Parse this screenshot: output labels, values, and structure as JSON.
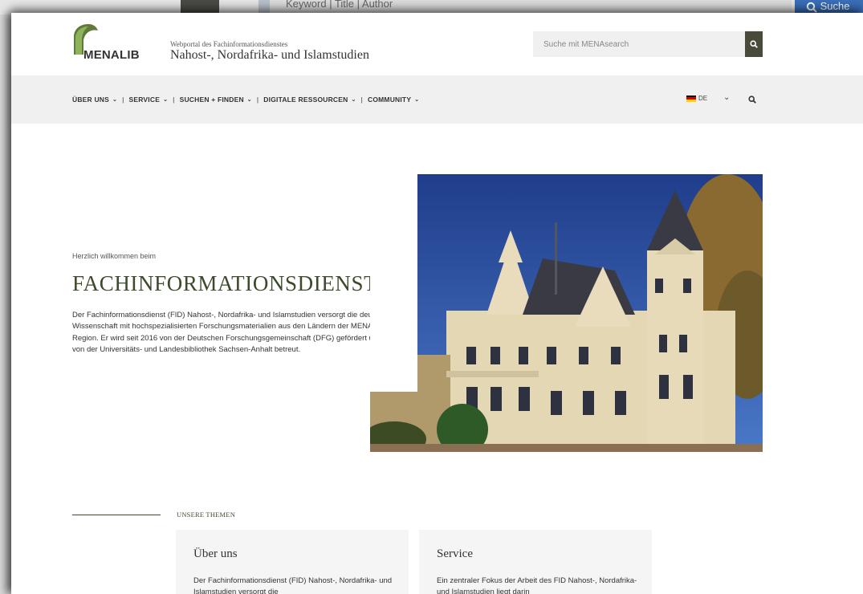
{
  "background": {
    "search_placeholder": "Keyword | Title | Author",
    "search_button": "Suche"
  },
  "header": {
    "logo_text": "MENALIB",
    "portal_small": "Webportal des Fachinformationsdienstes",
    "portal_big": "Nahost-, Nordafrika- und Islamstudien",
    "search_placeholder": "Suche mit MENAsearch"
  },
  "nav": {
    "items": [
      {
        "label": "ÜBER UNS"
      },
      {
        "label": "SERVICE"
      },
      {
        "label": "SUCHEN + FINDEN"
      },
      {
        "label": "DIGITALE RESSOURCEN"
      },
      {
        "label": "COMMUNITY"
      }
    ],
    "lang": "DE"
  },
  "intro": {
    "greeting": "Herzlich willkommen beim",
    "title": "FACHINFORMATIONSDIENST",
    "text": "Der Fachinformationsdienst (FID) Nahost-, Nordafrika- und Islamstudien versorgt die deutsche Wissenschaft mit hochspezialisierten Forschungsmaterialien aus den Ländern der MENA-Region. Er wird seit 2016 von der Deutschen Forschungsgemeinschaft (DFG) gefördert und von der Universitäts- und Landesbibliothek Sachsen-Anhalt betreut."
  },
  "themes": {
    "label": "UNSERE THEMEN",
    "cards": [
      {
        "title": "Über uns",
        "text": "Der Fachinformationsdienst (FID) Nahost-, Nordafrika- und Islamstudien versorgt die"
      },
      {
        "title": "Service",
        "text": "Ein zentraler Fokus der Arbeit des FID Nahost-, Nordafrika- und Islamstudien liegt darin"
      }
    ]
  },
  "colors": {
    "brand_green": "#3d4a2c",
    "nav_bg": "#f0f0f0",
    "search_button": "#4a4a3a"
  }
}
